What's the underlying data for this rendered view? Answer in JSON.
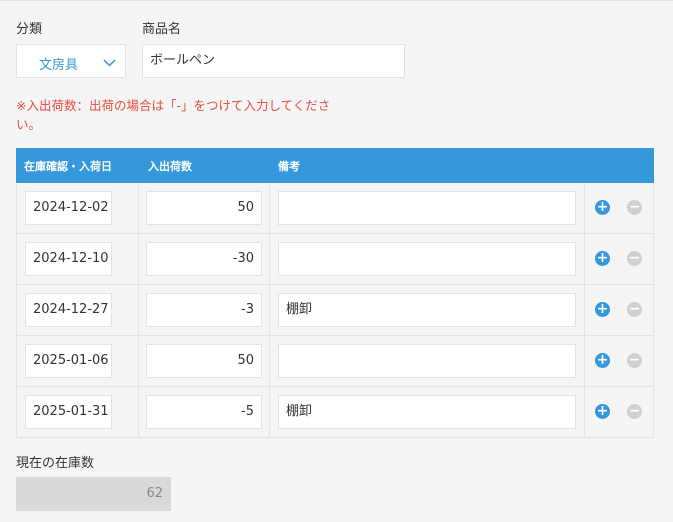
{
  "fields": {
    "category_label": "分類",
    "category_value": "文房具",
    "product_label": "商品名",
    "product_value": "ボールペン"
  },
  "note": "※入出荷数：出荷の場合は「-」をつけて入力してください。",
  "table": {
    "headers": [
      "在庫確認・入荷日",
      "入出荷数",
      "備考"
    ],
    "rows": [
      {
        "date": "2024-12-02",
        "qty": "50",
        "memo": ""
      },
      {
        "date": "2024-12-10",
        "qty": "-30",
        "memo": ""
      },
      {
        "date": "2024-12-27",
        "qty": "-3",
        "memo": "棚卸"
      },
      {
        "date": "2025-01-06",
        "qty": "50",
        "memo": ""
      },
      {
        "date": "2025-01-31",
        "qty": "-5",
        "memo": "棚卸"
      }
    ],
    "add_icon": "plus-circle-icon",
    "remove_icon": "minus-circle-icon"
  },
  "stock": {
    "label": "現在の在庫数",
    "value": "62"
  },
  "colors": {
    "accent": "#3498db",
    "warning": "#e74c3c",
    "disabled": "#d0d0d0"
  }
}
